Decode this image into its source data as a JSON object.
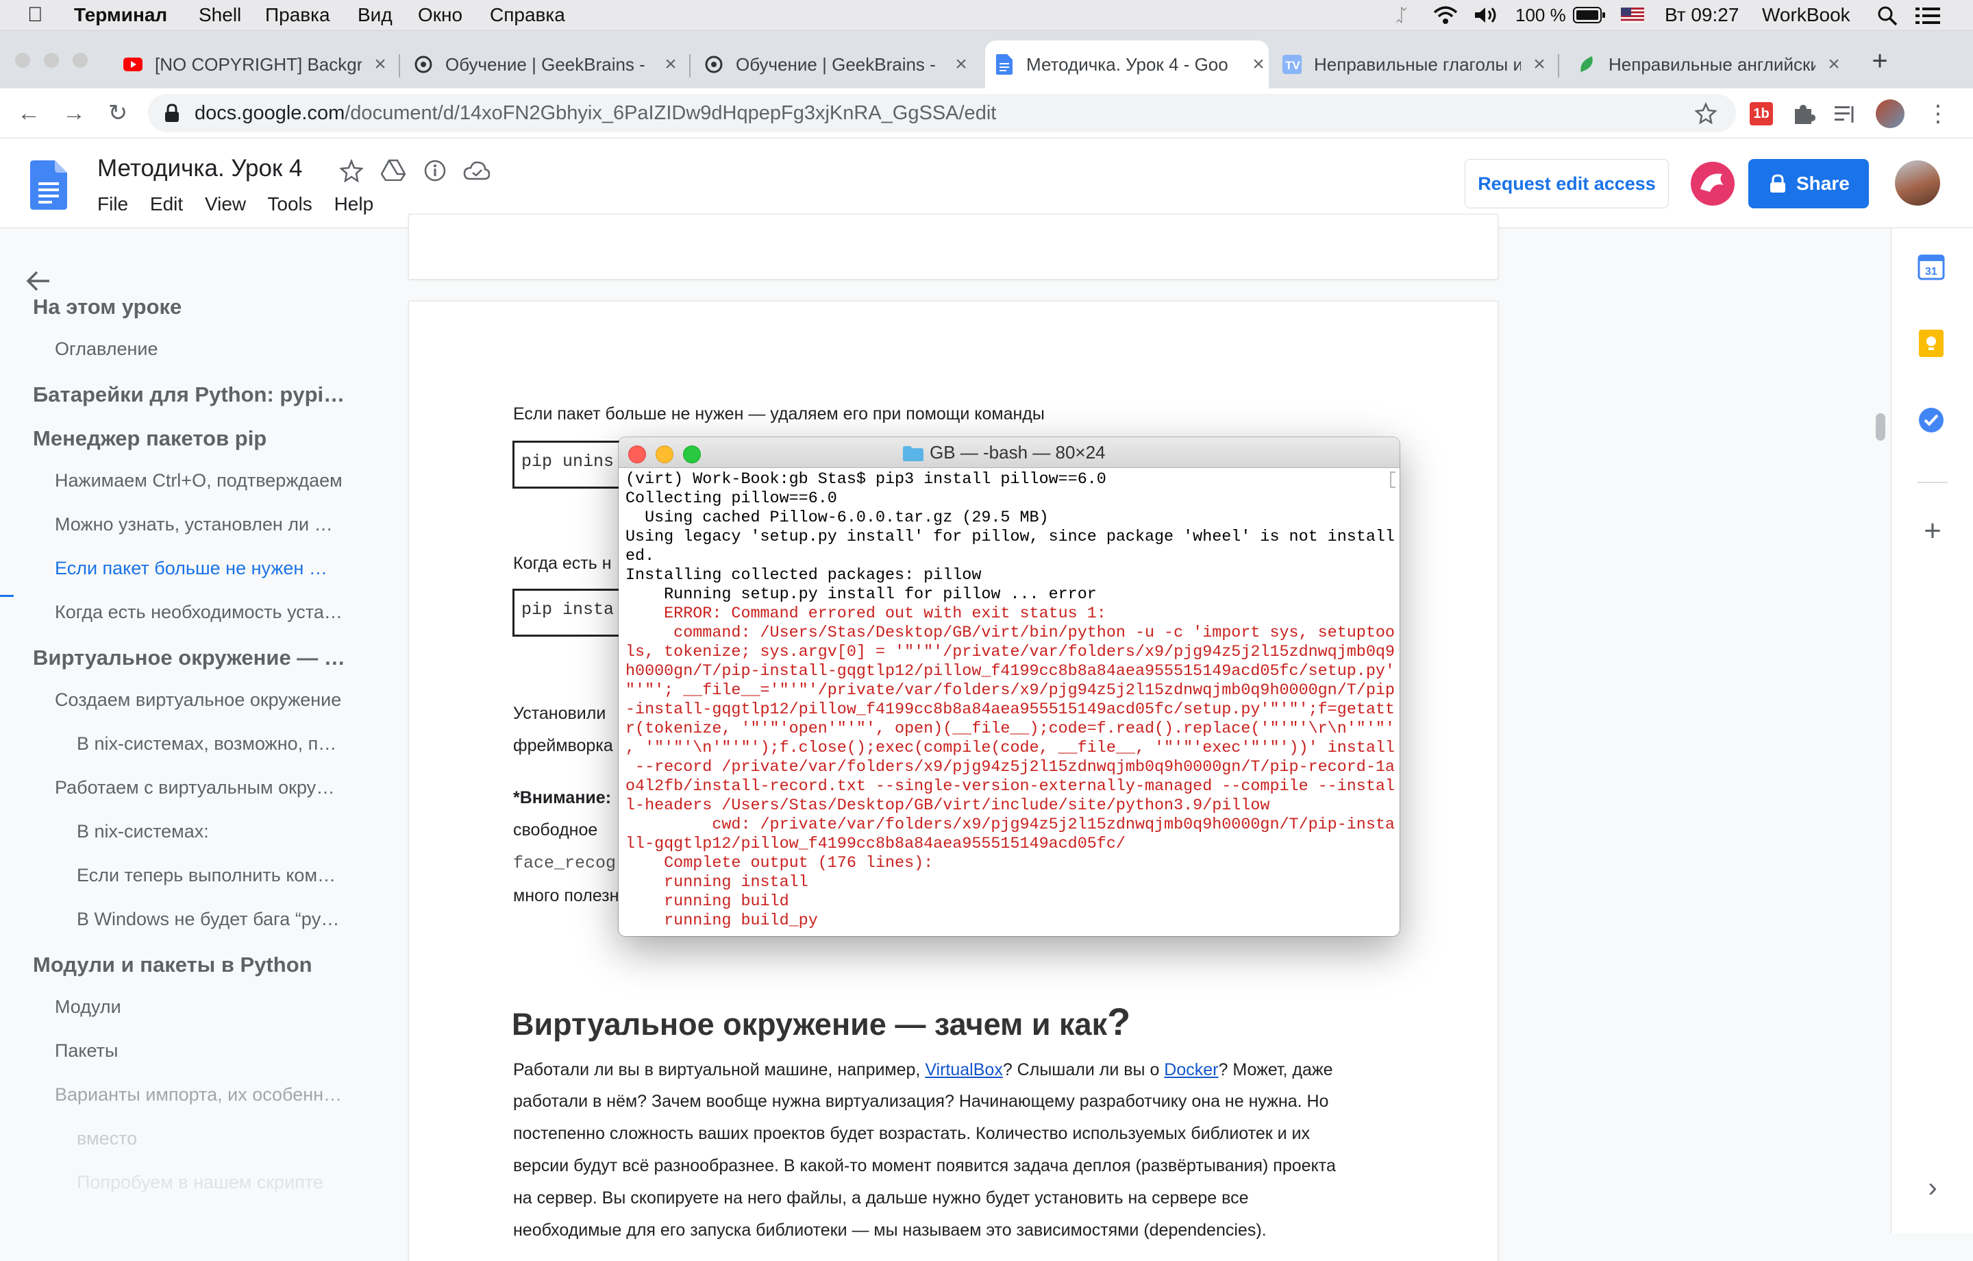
{
  "menubar": {
    "app": "Терминал",
    "items": [
      "Shell",
      "Правка",
      "Вид",
      "Окно",
      "Справка"
    ],
    "battery": "100 %",
    "clock": "Вт 09:27",
    "user": "WorkBook"
  },
  "tabs": [
    {
      "title": "[NO COPYRIGHT] Backgro",
      "icon": "youtube-icon"
    },
    {
      "title": "Обучение | GeekBrains -",
      "icon": "geekbrains-icon"
    },
    {
      "title": "Обучение | GeekBrains -",
      "icon": "geekbrains-icon"
    },
    {
      "title": "Методичка. Урок 4 - Goo",
      "icon": "google-docs-icon",
      "active": true
    },
    {
      "title": "Неправильные глаголы и",
      "icon": "tv-icon"
    },
    {
      "title": "Неправильные английски",
      "icon": "leaf-icon"
    }
  ],
  "address": {
    "host": "docs.google.com",
    "path": "/document/d/14xoFN2Gbhyix_6PaIZIDw9dHqpepFg3xjKnRA_GgSSA/edit"
  },
  "docs": {
    "title": "Методичка. Урок 4",
    "menu": [
      "File",
      "Edit",
      "View",
      "Tools",
      "Help"
    ],
    "request_edit": "Request edit access",
    "share": "Share"
  },
  "outline": [
    {
      "text": "На этом уроке",
      "level": 1
    },
    {
      "text": "Оглавление",
      "level": 2
    },
    {
      "text": "Батарейки для Python: pypi.org",
      "level": 1
    },
    {
      "text": "Менеджер пакетов pip",
      "level": 1
    },
    {
      "text": "Нажимаем Ctrl+O, подтверждаем",
      "level": 2
    },
    {
      "text": "Можно узнать, установлен ли пакет",
      "level": 2
    },
    {
      "text": "Если пакет больше не нужен — удаляем",
      "level": 2,
      "active": true
    },
    {
      "text": "Когда есть необходимость установить",
      "level": 2
    },
    {
      "text": "Виртуальное окружение — зачем и как",
      "level": 1
    },
    {
      "text": "Создаем виртуальное окружение",
      "level": 2
    },
    {
      "text": "В nix-системах, возможно, придется",
      "level": 3
    },
    {
      "text": "Работаем с виртуальным окружением",
      "level": 2
    },
    {
      "text": "В nix-системах:",
      "level": 3
    },
    {
      "text": "Если теперь выполнить команду",
      "level": 3
    },
    {
      "text": "В Windows не будет бага “python”",
      "level": 3
    },
    {
      "text": "Модули и пакеты в Python",
      "level": 1
    },
    {
      "text": "Модули",
      "level": 2
    },
    {
      "text": "Пакеты",
      "level": 2
    },
    {
      "text": "Варианты импорта, их особенности",
      "level": 2,
      "fade": 1
    },
    {
      "text": "вместо",
      "level": 3,
      "fade": 2
    },
    {
      "text": "Попробуем в нашем скрипте",
      "level": 3,
      "fade": 3
    }
  ],
  "doc": {
    "para1": "Если пакет больше не нужен — удаляем его при помощи команды",
    "code1": "pip unins",
    "para2": "Когда есть н",
    "code2": "pip insta",
    "para3a": "Установили",
    "para3b": "фреймворка",
    "attention_bold": "*Внимание:",
    "para4a": "свободное",
    "para4code": "face_recog",
    "para4c": "много полезн",
    "heading": "Виртуальное окружение — зачем и как",
    "heading_q": "?",
    "body1a": "Работали ли вы в виртуальной машине, например, ",
    "body1link1": "VirtualBox",
    "body1b": "? Слышали ли вы о ",
    "body1link2": "Docker",
    "body1c": "? Может, даже",
    "body2": "работали в нём? Зачем вообще нужна виртуализация? Начинающему разработчику она не нужна. Но",
    "body3": "постепенно сложность ваших проектов будет возрастать. Количество используемых библиотек и их",
    "body4": "версии будут всё разнообразнее. В какой-то момент появится задача деплоя (развёртывания) проекта",
    "body5": "на сервер. Вы скопируете на него файлы, а дальше нужно будет установить на сервере все",
    "body6": "необходимые для его запуска библиотеки — мы называем это зависимостями (dependencies)."
  },
  "terminal": {
    "title": "GB — -bash — 80×24",
    "lines": [
      {
        "t": "(virt) Work-Book:gb Stas$ pip3 install pillow==6.0",
        "k": "out"
      },
      {
        "t": "Collecting pillow==6.0",
        "k": "out"
      },
      {
        "t": "  Using cached Pillow-6.0.0.tar.gz (29.5 MB)",
        "k": "out"
      },
      {
        "t": "Using legacy 'setup.py install' for pillow, since package 'wheel' is not install",
        "k": "out"
      },
      {
        "t": "ed.",
        "k": "out"
      },
      {
        "t": "Installing collected packages: pillow",
        "k": "out"
      },
      {
        "t": "    Running setup.py install for pillow ... error",
        "k": "out"
      },
      {
        "t": "    ERROR: Command errored out with exit status 1:",
        "k": "err"
      },
      {
        "t": "     command: /Users/Stas/Desktop/GB/virt/bin/python -u -c 'import sys, setuptoo",
        "k": "err"
      },
      {
        "t": "ls, tokenize; sys.argv[0] = '\"'\"'/private/var/folders/x9/pjg94z5j2l15zdnwqjmb0q9",
        "k": "err"
      },
      {
        "t": "h0000gn/T/pip-install-gqgtlp12/pillow_f4199cc8b8a84aea955515149acd05fc/setup.py'",
        "k": "err"
      },
      {
        "t": "\"'\"'; __file__='\"'\"'/private/var/folders/x9/pjg94z5j2l15zdnwqjmb0q9h0000gn/T/pip",
        "k": "err"
      },
      {
        "t": "-install-gqgtlp12/pillow_f4199cc8b8a84aea955515149acd05fc/setup.py'\"'\"';f=getatt",
        "k": "err"
      },
      {
        "t": "r(tokenize, '\"'\"'open'\"'\"', open)(__file__);code=f.read().replace('\"'\"'\\r\\n'\"'\"'",
        "k": "err"
      },
      {
        "t": ", '\"'\"'\\n'\"'\"');f.close();exec(compile(code, __file__, '\"'\"'exec'\"'\"'))' install",
        "k": "err"
      },
      {
        "t": " --record /private/var/folders/x9/pjg94z5j2l15zdnwqjmb0q9h0000gn/T/pip-record-1a",
        "k": "err"
      },
      {
        "t": "o4l2fb/install-record.txt --single-version-externally-managed --compile --instal",
        "k": "err"
      },
      {
        "t": "l-headers /Users/Stas/Desktop/GB/virt/include/site/python3.9/pillow",
        "k": "err"
      },
      {
        "t": "         cwd: /private/var/folders/x9/pjg94z5j2l15zdnwqjmb0q9h0000gn/T/pip-insta",
        "k": "err"
      },
      {
        "t": "ll-gqgtlp12/pillow_f4199cc8b8a84aea955515149acd05fc/",
        "k": "err"
      },
      {
        "t": "    Complete output (176 lines):",
        "k": "err"
      },
      {
        "t": "    running install",
        "k": "err"
      },
      {
        "t": "    running build",
        "k": "err"
      },
      {
        "t": "    running build_py",
        "k": "err"
      }
    ]
  },
  "colors": {
    "accent": "#1a73e8",
    "error": "#c9211e",
    "docs_blue": "#4285f4"
  }
}
